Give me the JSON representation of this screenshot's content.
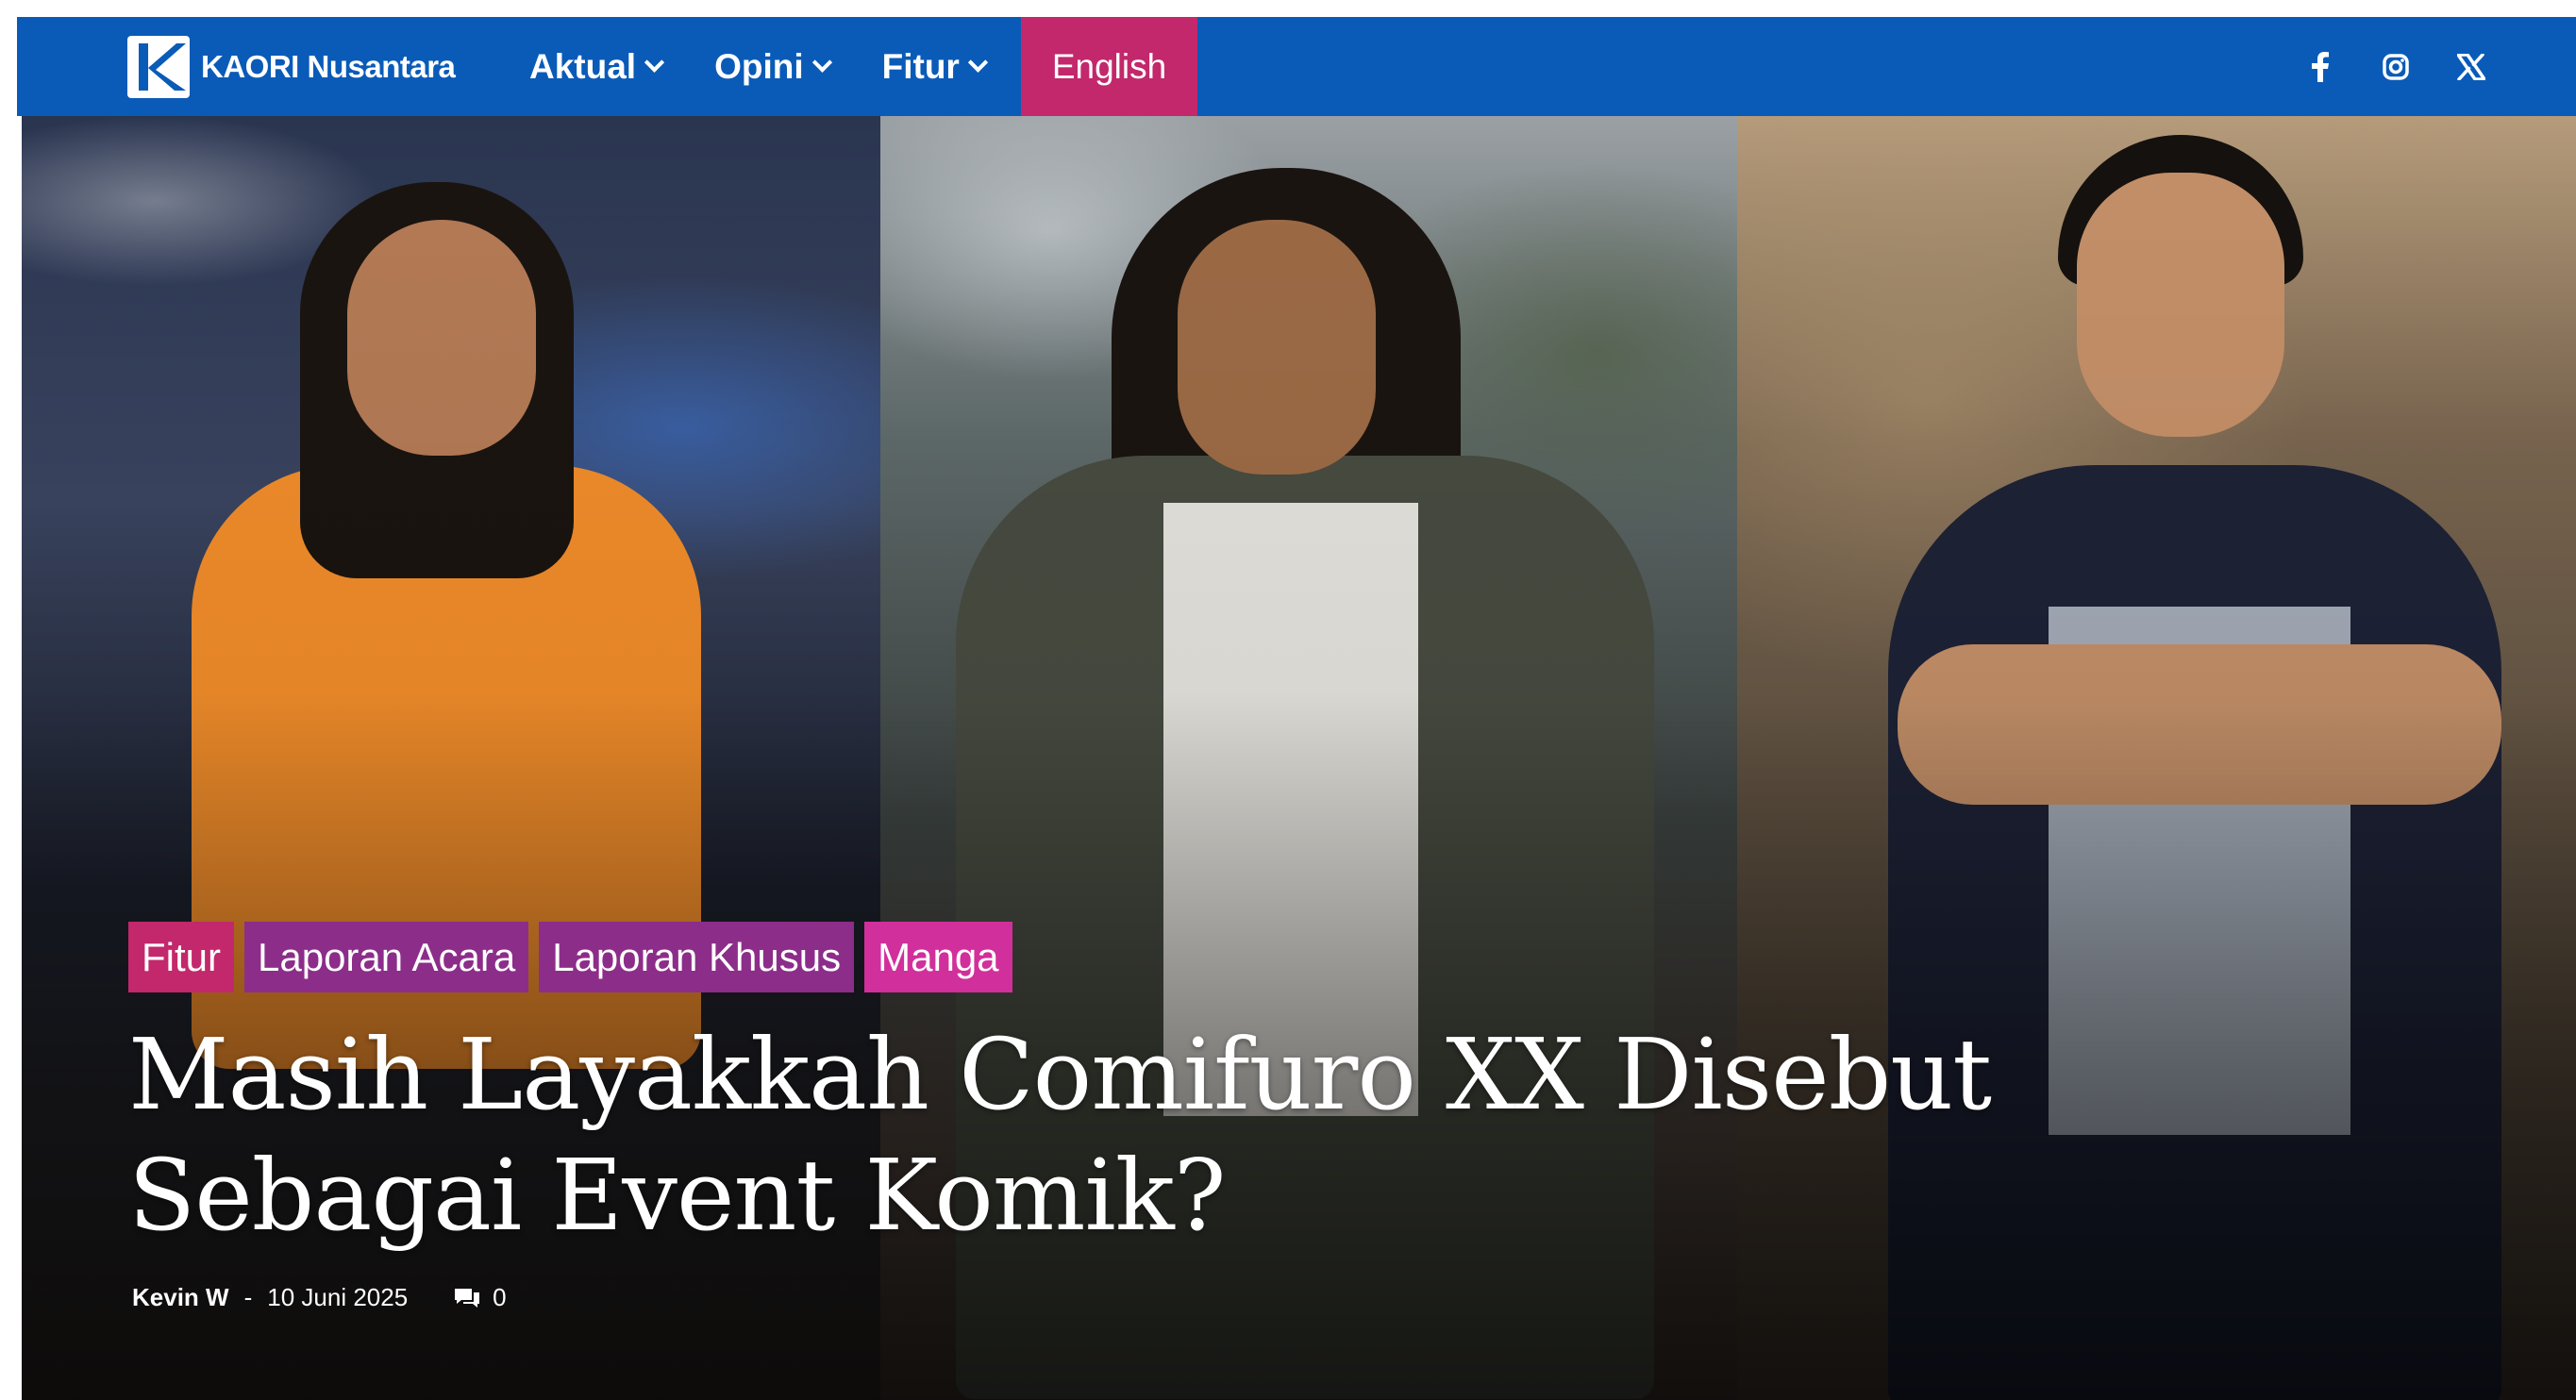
{
  "brand": {
    "name": "KAORI Nusantara",
    "logo_icon": "kaori-k-logo-icon"
  },
  "nav": {
    "items": [
      {
        "label": "Aktual",
        "has_dropdown": true
      },
      {
        "label": "Opini",
        "has_dropdown": true
      },
      {
        "label": "Fitur",
        "has_dropdown": true
      }
    ],
    "english_label": "English",
    "english_color": "#c2286b",
    "bar_color": "#0a5bb8"
  },
  "social": [
    {
      "icon": "facebook-icon"
    },
    {
      "icon": "instagram-icon"
    },
    {
      "icon": "x-twitter-icon"
    }
  ],
  "article": {
    "tags": [
      {
        "label": "Fitur",
        "color": "#c2286b"
      },
      {
        "label": "Laporan Acara",
        "color": "#8c2d8a"
      },
      {
        "label": "Laporan Khusus",
        "color": "#8c2d8a"
      },
      {
        "label": "Manga",
        "color": "#d12f9c"
      }
    ],
    "title_line1": "Masih Layakkah Comifuro XX Disebut",
    "title_line2": "Sebagai Event Komik?",
    "author": "Kevin W",
    "separator": "-",
    "date": "10 Juni 2025",
    "comment_icon": "comments-icon",
    "comment_count": "0"
  }
}
